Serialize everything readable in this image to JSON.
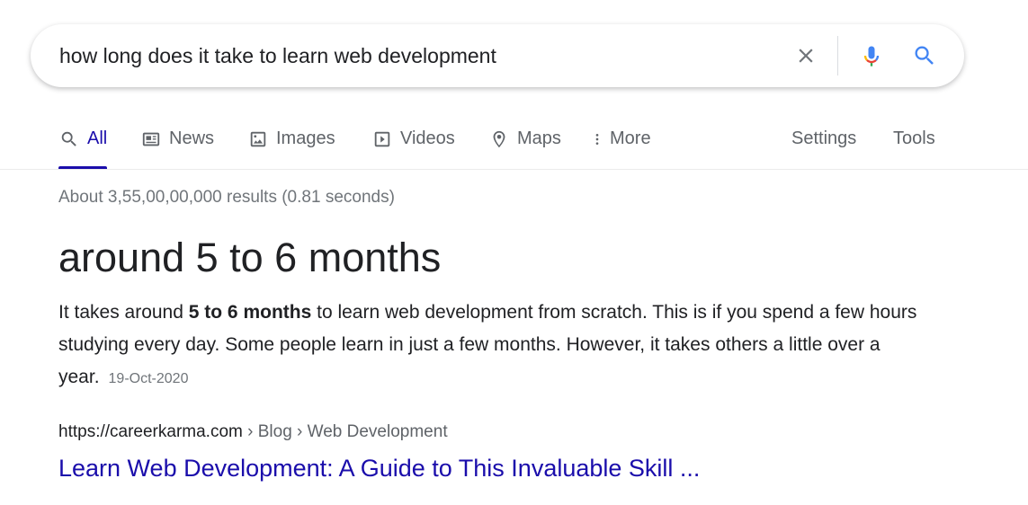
{
  "search": {
    "query": "how long does it take to learn web development",
    "clear_icon": "close-icon",
    "mic_icon": "microphone-icon",
    "search_icon": "search-icon"
  },
  "tabs": {
    "all": "All",
    "news": "News",
    "images": "Images",
    "videos": "Videos",
    "maps": "Maps",
    "more": "More",
    "settings": "Settings",
    "tools": "Tools",
    "active": "All"
  },
  "results": {
    "stats": "About 3,55,00,00,000 results (0.81 seconds)",
    "featured": {
      "answer": "around 5 to 6 months",
      "snippet_pre": "It takes around ",
      "snippet_bold": "5 to 6 months",
      "snippet_post": " to learn web development from scratch. This is if you spend a few hours studying every day. Some people learn in just a few months. However, it takes others a little over a year.",
      "date": "19-Oct-2020"
    },
    "source": {
      "domain": "https://careerkarma.com",
      "breadcrumbs": " › Blog › Web Development",
      "title": "Learn Web Development: A Guide to This Invaluable Skill ..."
    }
  },
  "colors": {
    "link": "#1a0dab",
    "text": "#202124",
    "muted": "#70757a",
    "tab_gray": "#5f6368",
    "mic_blue": "#4285f4"
  }
}
